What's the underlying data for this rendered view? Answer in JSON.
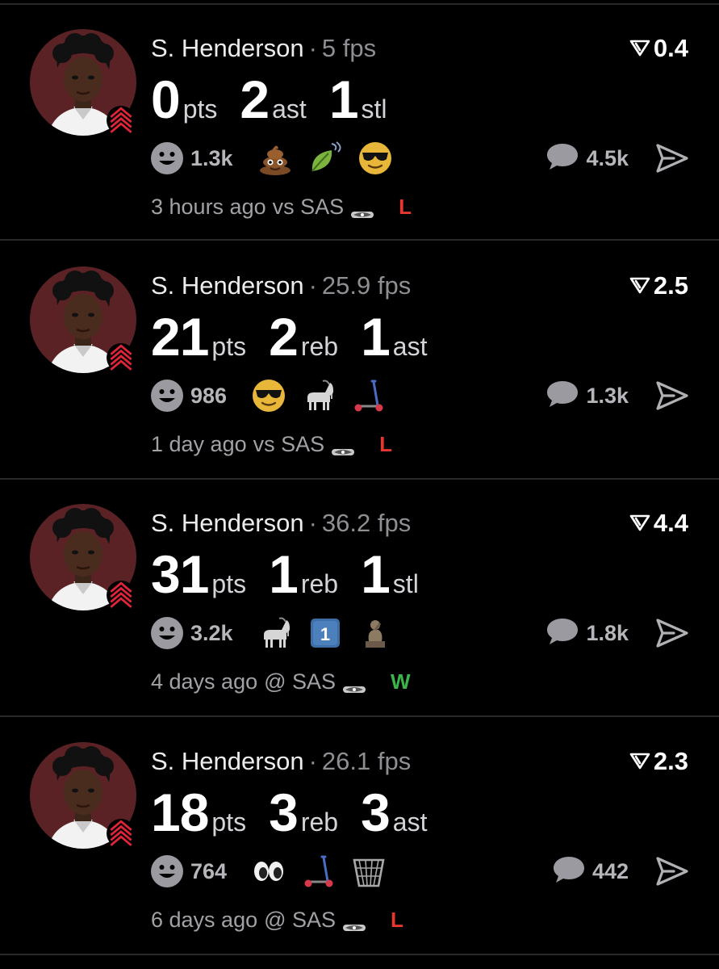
{
  "colors": {
    "background": "#000000",
    "win": "#3bb44a",
    "loss": "#e5372e",
    "secondary_text": "#a1a1a6",
    "avatar_bg": "#5b2226"
  },
  "posts": [
    {
      "player": "S. Henderson",
      "separator": "·",
      "fps": "5 fps",
      "score": "0.4",
      "stats": [
        {
          "value": "0",
          "unit": "pts"
        },
        {
          "value": "2",
          "unit": "ast"
        },
        {
          "value": "1",
          "unit": "stl"
        }
      ],
      "reaction_count": "1.3k",
      "emojis": [
        "poop-emoji",
        "leaf-wind-emoji",
        "sunglasses-emoji"
      ],
      "comment_count": "4.5k",
      "time": "3 hours ago",
      "opponent": "vs SAS",
      "team_logo": "spurs-logo",
      "result": "L"
    },
    {
      "player": "S. Henderson",
      "separator": "·",
      "fps": "25.9 fps",
      "score": "2.5",
      "stats": [
        {
          "value": "21",
          "unit": "pts"
        },
        {
          "value": "2",
          "unit": "reb"
        },
        {
          "value": "1",
          "unit": "ast"
        }
      ],
      "reaction_count": "986",
      "emojis": [
        "sunglasses-emoji",
        "goat-emoji",
        "scooter-emoji"
      ],
      "comment_count": "1.3k",
      "time": "1 day ago",
      "opponent": "vs SAS",
      "team_logo": "spurs-logo",
      "result": "L"
    },
    {
      "player": "S. Henderson",
      "separator": "·",
      "fps": "36.2 fps",
      "score": "4.4",
      "stats": [
        {
          "value": "31",
          "unit": "pts"
        },
        {
          "value": "1",
          "unit": "reb"
        },
        {
          "value": "1",
          "unit": "stl"
        }
      ],
      "reaction_count": "3.2k",
      "emojis": [
        "goat-emoji",
        "keycap-one-emoji",
        "statue-emoji"
      ],
      "comment_count": "1.8k",
      "time": "4 days ago",
      "opponent": "@ SAS",
      "team_logo": "spurs-logo",
      "result": "W"
    },
    {
      "player": "S. Henderson",
      "separator": "·",
      "fps": "26.1 fps",
      "score": "2.3",
      "stats": [
        {
          "value": "18",
          "unit": "pts"
        },
        {
          "value": "3",
          "unit": "reb"
        },
        {
          "value": "3",
          "unit": "ast"
        }
      ],
      "reaction_count": "764",
      "emojis": [
        "eyes-emoji",
        "scooter-emoji",
        "hoop-emoji"
      ],
      "comment_count": "442",
      "time": "6 days ago",
      "opponent": "@ SAS",
      "team_logo": "spurs-logo",
      "result": "L"
    }
  ]
}
